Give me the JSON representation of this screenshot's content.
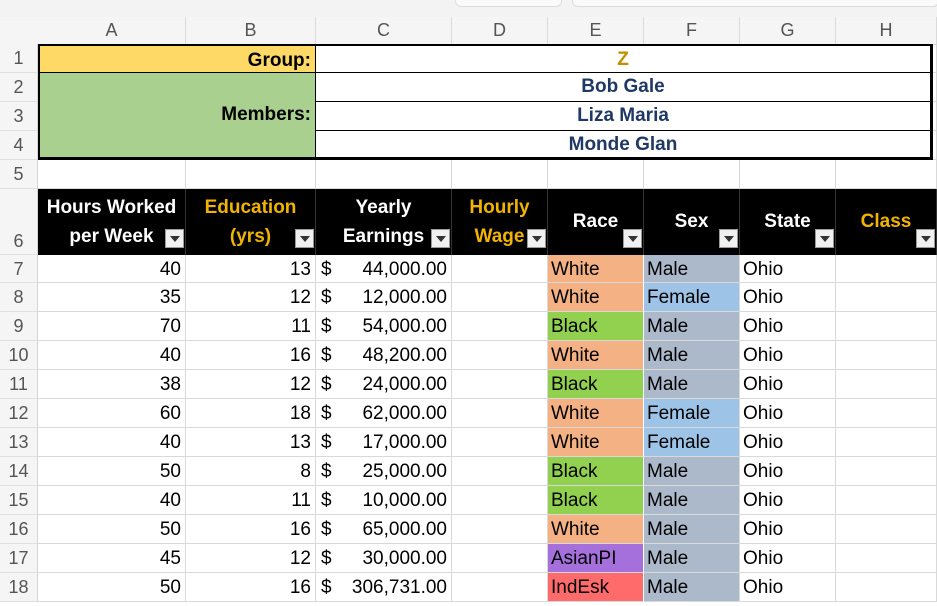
{
  "columns": [
    "A",
    "B",
    "C",
    "D",
    "E",
    "F",
    "G",
    "H"
  ],
  "rows": [
    "1",
    "2",
    "3",
    "4",
    "5",
    "6",
    "7",
    "8",
    "9",
    "10",
    "11",
    "12",
    "13",
    "14",
    "15",
    "16",
    "17",
    "18"
  ],
  "group_block": {
    "group_label": "Group:",
    "group_value": "Z",
    "members_label": "Members:",
    "members": [
      "Bob Gale",
      "Liza Maria",
      "Monde Glan"
    ]
  },
  "headers": {
    "hours_l1": "Hours Worked",
    "hours_l2": "per Week",
    "edu_l1": "Education",
    "edu_l2": "(yrs)",
    "earn_l1": "Yearly",
    "earn_l2": "Earnings",
    "wage_l1": "Hourly",
    "wage_l2": "Wage",
    "race": "Race",
    "sex": "Sex",
    "state": "State",
    "class": "Class"
  },
  "data_rows": [
    {
      "hours": "40",
      "edu": "13",
      "dollar": "$",
      "earn": "44,000.00",
      "race": "White",
      "sex": "Male",
      "state": "Ohio"
    },
    {
      "hours": "35",
      "edu": "12",
      "dollar": "$",
      "earn": "12,000.00",
      "race": "White",
      "sex": "Female",
      "state": "Ohio"
    },
    {
      "hours": "70",
      "edu": "11",
      "dollar": "$",
      "earn": "54,000.00",
      "race": "Black",
      "sex": "Male",
      "state": "Ohio"
    },
    {
      "hours": "40",
      "edu": "16",
      "dollar": "$",
      "earn": "48,200.00",
      "race": "White",
      "sex": "Male",
      "state": "Ohio"
    },
    {
      "hours": "38",
      "edu": "12",
      "dollar": "$",
      "earn": "24,000.00",
      "race": "Black",
      "sex": "Male",
      "state": "Ohio"
    },
    {
      "hours": "60",
      "edu": "18",
      "dollar": "$",
      "earn": "62,000.00",
      "race": "White",
      "sex": "Female",
      "state": "Ohio"
    },
    {
      "hours": "40",
      "edu": "13",
      "dollar": "$",
      "earn": "17,000.00",
      "race": "White",
      "sex": "Female",
      "state": "Ohio"
    },
    {
      "hours": "50",
      "edu": "8",
      "dollar": "$",
      "earn": "25,000.00",
      "race": "Black",
      "sex": "Male",
      "state": "Ohio"
    },
    {
      "hours": "40",
      "edu": "11",
      "dollar": "$",
      "earn": "10,000.00",
      "race": "Black",
      "sex": "Male",
      "state": "Ohio"
    },
    {
      "hours": "50",
      "edu": "16",
      "dollar": "$",
      "earn": "65,000.00",
      "race": "White",
      "sex": "Male",
      "state": "Ohio"
    },
    {
      "hours": "45",
      "edu": "12",
      "dollar": "$",
      "earn": "30,000.00",
      "race": "AsianPI",
      "sex": "Male",
      "state": "Ohio"
    },
    {
      "hours": "50",
      "edu": "16",
      "dollar": "$",
      "earn": "306,731.00",
      "race": "IndEsk",
      "sex": "Male",
      "state": "Ohio"
    }
  ],
  "colors": {
    "group_label_bg": "#ffd966",
    "members_label_bg": "#a9d08e",
    "group_value_text": "#bf8f00",
    "member_text": "#1f3864",
    "header_bg": "#000000",
    "header_gold": "#f0b400",
    "race": {
      "White": "#f4b183",
      "Black": "#92d050",
      "AsianPI": "#a56fdc",
      "IndEsk": "#ff6b6b"
    },
    "sex": {
      "Male": "#acb9ca",
      "Female": "#9dc3e6"
    }
  },
  "icons": {
    "filter": "filter-dropdown-icon",
    "select_all": "select-all-corner-icon"
  }
}
